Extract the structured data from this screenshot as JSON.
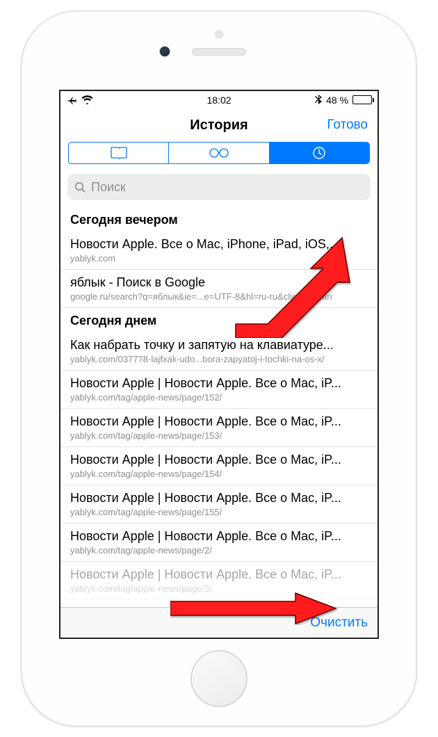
{
  "status": {
    "time": "18:02",
    "battery_pct": "48 %"
  },
  "nav": {
    "title": "История",
    "done": "Готово"
  },
  "segmented": {
    "tabs": [
      {
        "icon": "bookmark-icon"
      },
      {
        "icon": "glasses-icon"
      },
      {
        "icon": "clock-icon"
      }
    ],
    "active_index": 2
  },
  "search": {
    "placeholder": "Поиск"
  },
  "sections": [
    {
      "header": "Сегодня вечером",
      "items": [
        {
          "title": "Новости Apple. Все о Mac, iPhone, iPad, iOS,...",
          "sub": "yablyk.com"
        },
        {
          "title": "яблык - Поиск в Google",
          "sub": "google.ru/search?q=яблык&ie=...e=UTF-8&hl=ru-ru&client=safari"
        }
      ]
    },
    {
      "header": "Сегодня днем",
      "items": [
        {
          "title": "Как набрать точку и запятую на клавиатуре...",
          "sub": "yablyk.com/037778-lajfxak-udo...bora-zapyatoj-i-tochki-na-os-x/"
        },
        {
          "title": "Новости Apple | Новости Apple. Все о Mac, iP...",
          "sub": "yablyk.com/tag/apple-news/page/152/"
        },
        {
          "title": "Новости Apple | Новости Apple. Все о Mac, iP...",
          "sub": "yablyk.com/tag/apple-news/page/153/"
        },
        {
          "title": "Новости Apple | Новости Apple. Все о Mac, iP...",
          "sub": "yablyk.com/tag/apple-news/page/154/"
        },
        {
          "title": "Новости Apple | Новости Apple. Все о Mac, iP...",
          "sub": "yablyk.com/tag/apple-news/page/155/"
        },
        {
          "title": "Новости Apple | Новости Apple. Все о Mac, iP...",
          "sub": "yablyk.com/tag/apple-news/page/2/"
        },
        {
          "title": "Новости Apple | Новости Apple. Все о Mac, iP...",
          "sub": "yablyk.com/tag/apple-news/page/3/"
        }
      ]
    }
  ],
  "toolbar": {
    "clear": "Очистить"
  }
}
